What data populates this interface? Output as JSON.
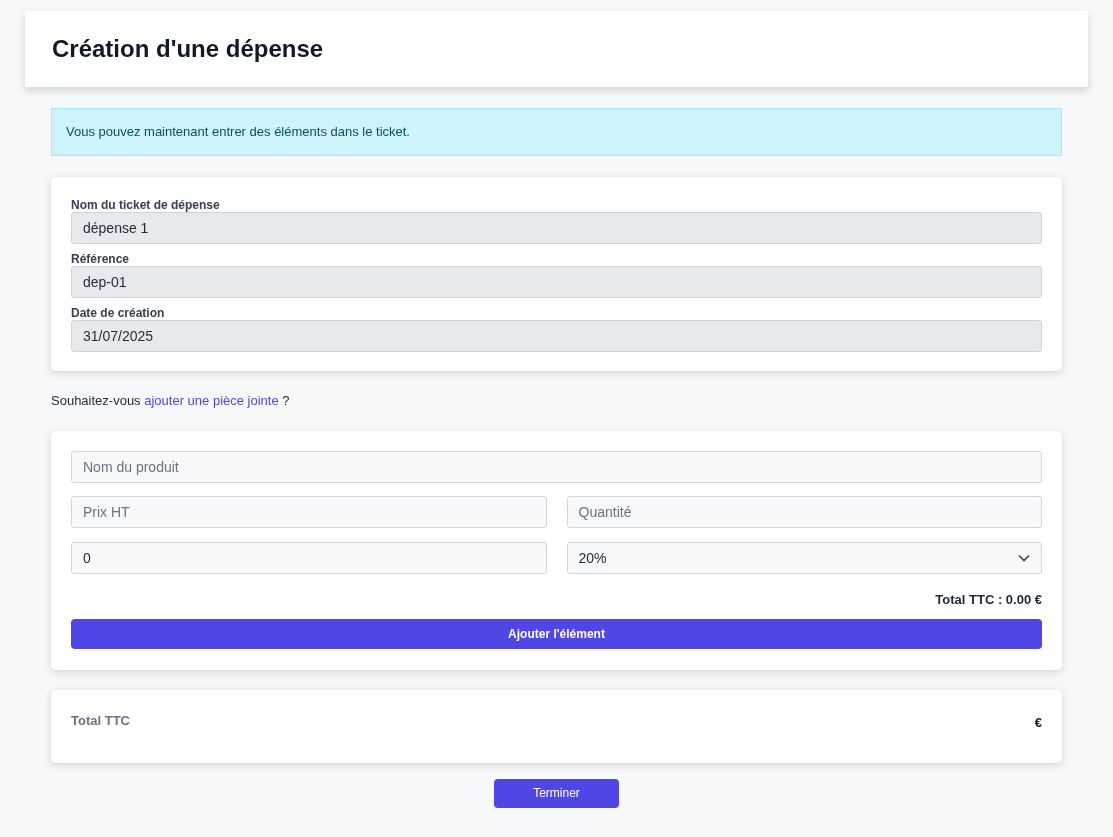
{
  "header": {
    "title": "Création d'une dépense"
  },
  "alert": {
    "text": "Vous pouvez maintenant entrer des éléments dans le ticket."
  },
  "ticket_fields": [
    {
      "label": "Nom du ticket de dépense",
      "value": "dépense 1",
      "disabled": true
    },
    {
      "label": "Référence",
      "value": "dep-01",
      "disabled": true
    },
    {
      "label": "Date de création",
      "value": "31/07/2025",
      "disabled": true
    }
  ],
  "attachment_prompt": {
    "before": "Souhaitez-vous",
    "link": "ajouter une pièce jointe",
    "after": "?"
  },
  "item_form": {
    "product": {
      "placeholder": "Nom du produit"
    },
    "price": {
      "placeholder": "Prix HT"
    },
    "quantity": {
      "placeholder": "Quantité"
    },
    "discount": {
      "value": "0"
    },
    "vat": {
      "value": "20%"
    },
    "total": "Total TTC : 0.00 €",
    "add_button": "Ajouter l'élément"
  },
  "summary": {
    "label": "Total TTC",
    "value": "€"
  },
  "finish_button": "Terminer"
}
